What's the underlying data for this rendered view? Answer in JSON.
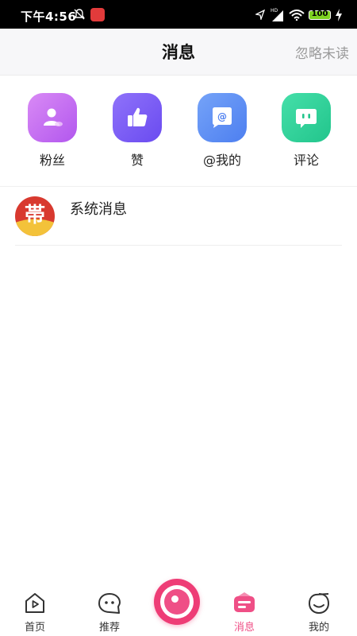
{
  "status_bar": {
    "time": "下午4:56",
    "battery": "100",
    "network": "HD"
  },
  "header": {
    "title": "消息",
    "ignore_unread": "忽略未读"
  },
  "categories": [
    {
      "label": "粉丝",
      "icon": "fans-icon",
      "color": "#c86cf0"
    },
    {
      "label": "赞",
      "icon": "thumbs-up-icon",
      "color": "#7a5cf5"
    },
    {
      "label": "@我的",
      "icon": "mention-icon",
      "color": "#5b8ff5"
    },
    {
      "label": "评论",
      "icon": "comment-icon",
      "color": "#2fd39c"
    }
  ],
  "messages": [
    {
      "name": "系统消息",
      "avatar_glyph": "帯"
    }
  ],
  "bottom_nav": [
    {
      "label": "首页",
      "icon": "home-icon"
    },
    {
      "label": "推荐",
      "icon": "recommend-icon"
    },
    {
      "label": "消息",
      "icon": "message-icon",
      "active": true
    },
    {
      "label": "我的",
      "icon": "profile-icon"
    }
  ],
  "colors": {
    "accent": "#ef4f86",
    "header_bg": "#f7f7f9"
  }
}
